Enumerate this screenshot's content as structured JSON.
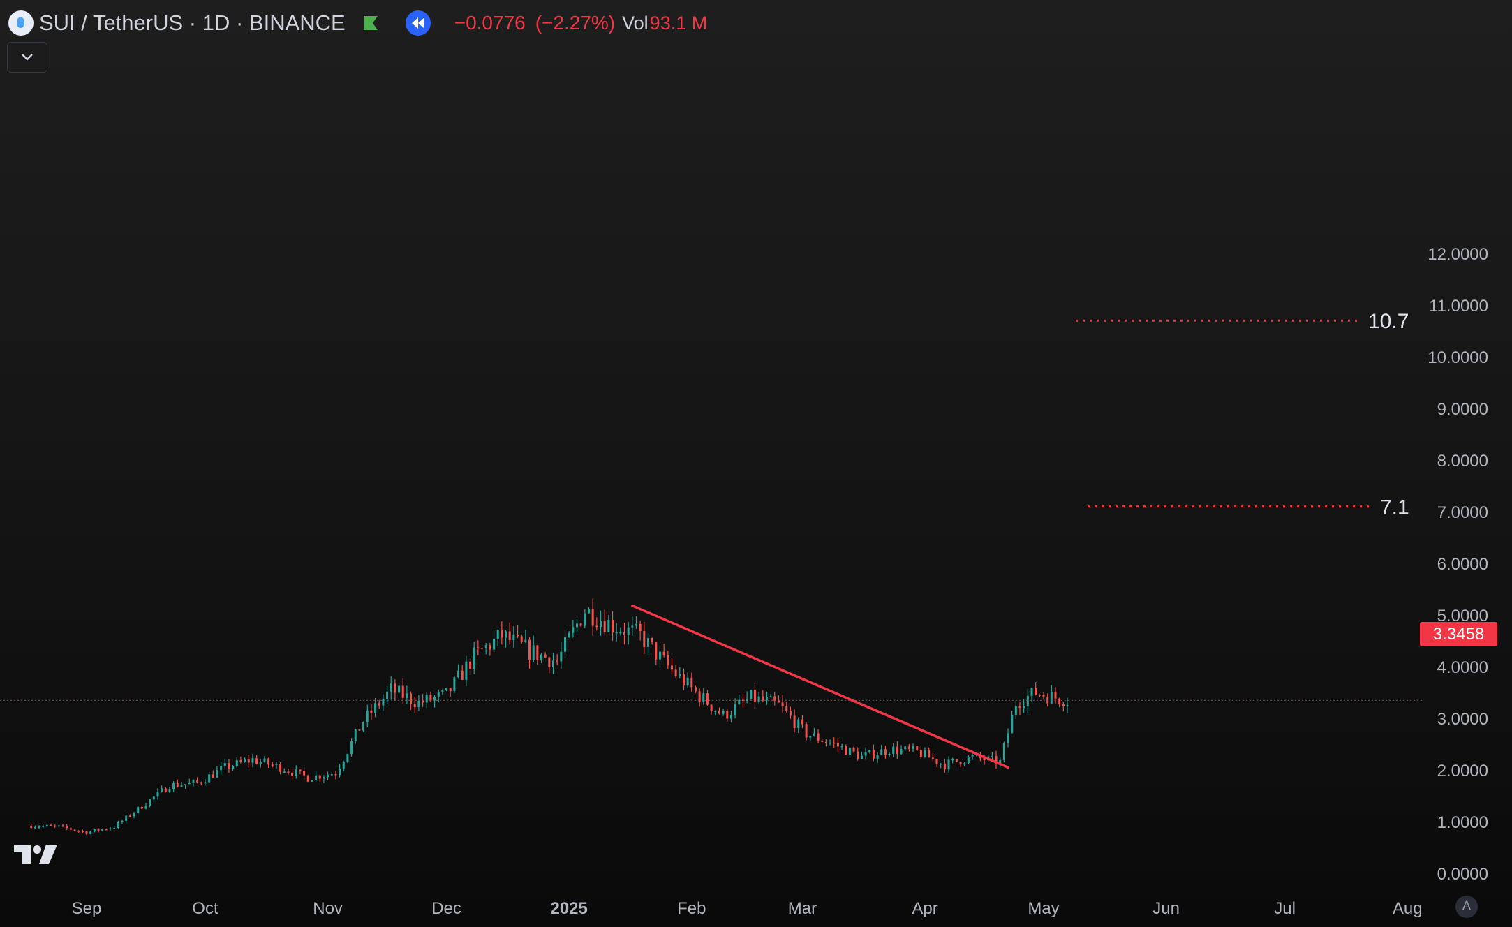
{
  "header": {
    "symbol": "SUI / TetherUS · 1D · BINANCE",
    "change": "−0.0776",
    "change_pct": "(−2.27%)",
    "volume_label": "Vol",
    "volume_value": "93.1 M"
  },
  "price_badge": "3.3458",
  "auto_label": "A",
  "colors": {
    "up": "#26a69a",
    "down": "#ef5350",
    "accent": "#2962ff",
    "trendline": "#f23645",
    "level_lines": "#f23645",
    "axis_text": "#b2b5be"
  },
  "icons": [
    "sui-icon",
    "flag-icon",
    "replay-icon",
    "chevron-down-icon",
    "tradingview-logo-icon"
  ],
  "chart_data": {
    "type": "candlestick",
    "interval": "1D",
    "y_axis": {
      "labels": [
        "12.0000",
        "11.0000",
        "10.0000",
        "9.0000",
        "8.0000",
        "7.0000",
        "6.0000",
        "5.0000",
        "4.0000",
        "3.0000",
        "2.0000",
        "1.0000",
        "0.0000"
      ],
      "ylim": [
        0,
        12
      ]
    },
    "x_axis": {
      "labels": [
        "Sep",
        "Oct",
        "Nov",
        "Dec",
        "2025",
        "Feb",
        "Mar",
        "Apr",
        "May",
        "Jun",
        "Jul",
        "Aug"
      ]
    },
    "current_price": 3.3458,
    "level_lines": [
      {
        "label": "10.7",
        "value": 10.7
      },
      {
        "label": "7.1",
        "value": 7.1
      }
    ],
    "trendline": {
      "from": {
        "date": "2025-01-17",
        "price": 5.18
      },
      "to": {
        "date": "2025-04-22",
        "price": 2.05
      }
    },
    "closes": [
      {
        "date": "2024-08-18",
        "close": 0.92
      },
      {
        "date": "2024-08-25",
        "close": 0.9
      },
      {
        "date": "2024-09-01",
        "close": 0.79
      },
      {
        "date": "2024-09-08",
        "close": 0.9
      },
      {
        "date": "2024-09-15",
        "close": 1.3
      },
      {
        "date": "2024-09-22",
        "close": 1.7
      },
      {
        "date": "2024-09-29",
        "close": 1.75
      },
      {
        "date": "2024-10-06",
        "close": 2.05
      },
      {
        "date": "2024-10-13",
        "close": 2.2
      },
      {
        "date": "2024-10-20",
        "close": 2.05
      },
      {
        "date": "2024-10-27",
        "close": 1.85
      },
      {
        "date": "2024-11-03",
        "close": 1.95
      },
      {
        "date": "2024-11-10",
        "close": 2.95
      },
      {
        "date": "2024-11-17",
        "close": 3.55
      },
      {
        "date": "2024-11-24",
        "close": 3.3
      },
      {
        "date": "2024-12-01",
        "close": 3.45
      },
      {
        "date": "2024-12-08",
        "close": 4.2
      },
      {
        "date": "2024-12-15",
        "close": 4.6
      },
      {
        "date": "2024-12-22",
        "close": 4.3
      },
      {
        "date": "2024-12-29",
        "close": 4.1
      },
      {
        "date": "2025-01-05",
        "close": 5.1
      },
      {
        "date": "2025-01-12",
        "close": 4.8
      },
      {
        "date": "2025-01-19",
        "close": 4.6
      },
      {
        "date": "2025-01-26",
        "close": 4.0
      },
      {
        "date": "2025-02-02",
        "close": 3.5
      },
      {
        "date": "2025-02-09",
        "close": 3.05
      },
      {
        "date": "2025-02-16",
        "close": 3.4
      },
      {
        "date": "2025-02-23",
        "close": 3.25
      },
      {
        "date": "2025-03-02",
        "close": 2.7
      },
      {
        "date": "2025-03-09",
        "close": 2.5
      },
      {
        "date": "2025-03-16",
        "close": 2.25
      },
      {
        "date": "2025-03-23",
        "close": 2.4
      },
      {
        "date": "2025-03-30",
        "close": 2.35
      },
      {
        "date": "2025-04-06",
        "close": 2.1
      },
      {
        "date": "2025-04-13",
        "close": 2.25
      },
      {
        "date": "2025-04-20",
        "close": 2.15
      },
      {
        "date": "2025-04-24",
        "close": 3.3
      },
      {
        "date": "2025-04-29",
        "close": 3.5
      },
      {
        "date": "2025-05-04",
        "close": 3.4
      },
      {
        "date": "2025-05-07",
        "close": 3.35
      }
    ]
  }
}
